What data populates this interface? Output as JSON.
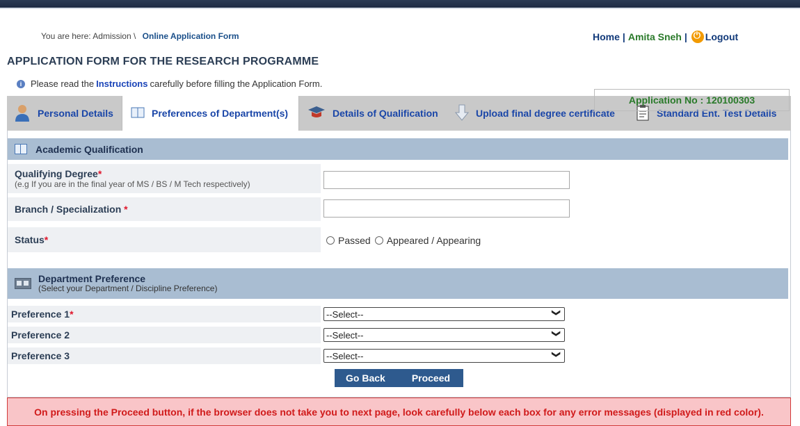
{
  "breadcrumb": {
    "prefix": "You are here:",
    "section": "Admission \\",
    "current": "Online Application Form"
  },
  "usernav": {
    "home": "Home",
    "sep1": "|",
    "user": "Amita Sneh",
    "sep2": "|",
    "logout": "Logout"
  },
  "page": {
    "title": "APPLICATION FORM FOR THE RESEARCH PROGRAMME"
  },
  "info": {
    "before": "Please read the",
    "link": "Instructions",
    "after": "carefully before filling the Application Form."
  },
  "application_no": "Application No : 120100303",
  "tabs": [
    {
      "label": "Personal Details",
      "icon": "person-icon"
    },
    {
      "label": "Preferences of Department(s)",
      "icon": "book-icon",
      "active": true
    },
    {
      "label": "Details of Qualification",
      "icon": "graduation-cap-icon"
    },
    {
      "label": "Upload final degree certificate",
      "icon": "download-arrow-icon"
    },
    {
      "label": "Standard Ent. Test Details",
      "icon": "clipboard-icon"
    }
  ],
  "academic": {
    "heading": "Academic Qualification",
    "degree_label": "Qualifying Degree",
    "degree_hint": "(e.g If you are in the final year of MS / BS / M Tech respectively)",
    "degree_value": "",
    "branch_label": "Branch / Specialization",
    "branch_value": "",
    "status_label": "Status",
    "status_options": [
      "Passed",
      "Appeared / Appearing"
    ],
    "required_mark": "*"
  },
  "department": {
    "heading": "Department Preference",
    "subheading": "(Select your Department / Discipline Preference)",
    "preferences": [
      {
        "label": "Preference 1",
        "required": true,
        "value": "--Select--"
      },
      {
        "label": "Preference 2",
        "required": false,
        "value": "--Select--"
      },
      {
        "label": "Preference 3",
        "required": false,
        "value": "--Select--"
      }
    ]
  },
  "buttons": {
    "back": "Go Back",
    "proceed": "Proceed"
  },
  "warning": "On pressing the Proceed button, if the browser does not take you to next page, look carefully below each box for any error messages (displayed in red color).",
  "colors": {
    "link_blue": "#1a46a8",
    "user_green": "#2a7a2a",
    "required_red": "#e0162b",
    "button_blue": "#2e5a8e",
    "section_head": "#a9bdd2",
    "warning_bg": "#f9c5c8"
  }
}
